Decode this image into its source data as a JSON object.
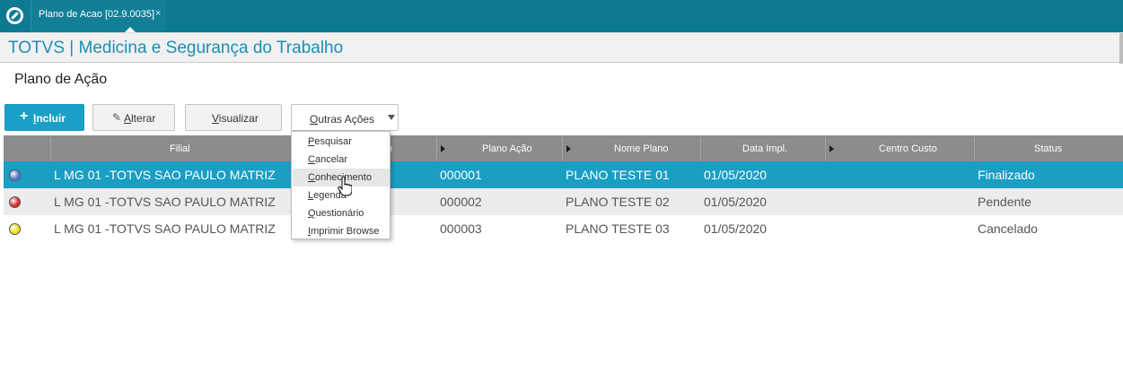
{
  "tab": {
    "label": "Plano de Acao [02.9.0035]",
    "close": "×"
  },
  "module": {
    "title": "TOTVS | Medicina e Segurança do Trabalho"
  },
  "page": {
    "title": "Plano de Ação"
  },
  "toolbar": {
    "incluir": "Incluir",
    "alterar": "Alterar",
    "visualizar": "Visualizar",
    "outras_acoes": "Outras Ações"
  },
  "grid": {
    "columns": [
      "Filial",
      "o",
      "Plano Ação",
      "Nome Plano",
      "Data Impl.",
      "Centro Custo",
      "Status"
    ],
    "rows": [
      {
        "status_color": "#5b7fcf",
        "filial": "L MG 01 -TOTVS SAO PAULO MATRIZ",
        "plano": "000001",
        "nome": "PLANO TESTE 01",
        "data": "01/05/2020",
        "centro": "",
        "status": "Finalizado",
        "selected": true
      },
      {
        "status_color": "#d92b2b",
        "filial": "L MG 01 -TOTVS SAO PAULO MATRIZ",
        "plano": "000002",
        "nome": "PLANO TESTE 02",
        "data": "01/05/2020",
        "centro": "",
        "status": "Pendente"
      },
      {
        "status_color": "#e8e020",
        "filial": "L MG 01 -TOTVS SAO PAULO MATRIZ",
        "plano": "000003",
        "nome": "PLANO TESTE 03",
        "data": "01/05/2020",
        "centro": "",
        "status": "Cancelado"
      }
    ]
  },
  "menu": {
    "items": [
      "Pesquisar",
      "Cancelar",
      "Conhecimento",
      "Legenda",
      "Questionário",
      "Imprimir Browse"
    ],
    "hovered": "Conhecimento"
  },
  "colors": {
    "topbar": "#0d7a92",
    "accent": "#1aa0c6",
    "selected_row": "#1a9ec3",
    "title": "#1a8fb5"
  }
}
